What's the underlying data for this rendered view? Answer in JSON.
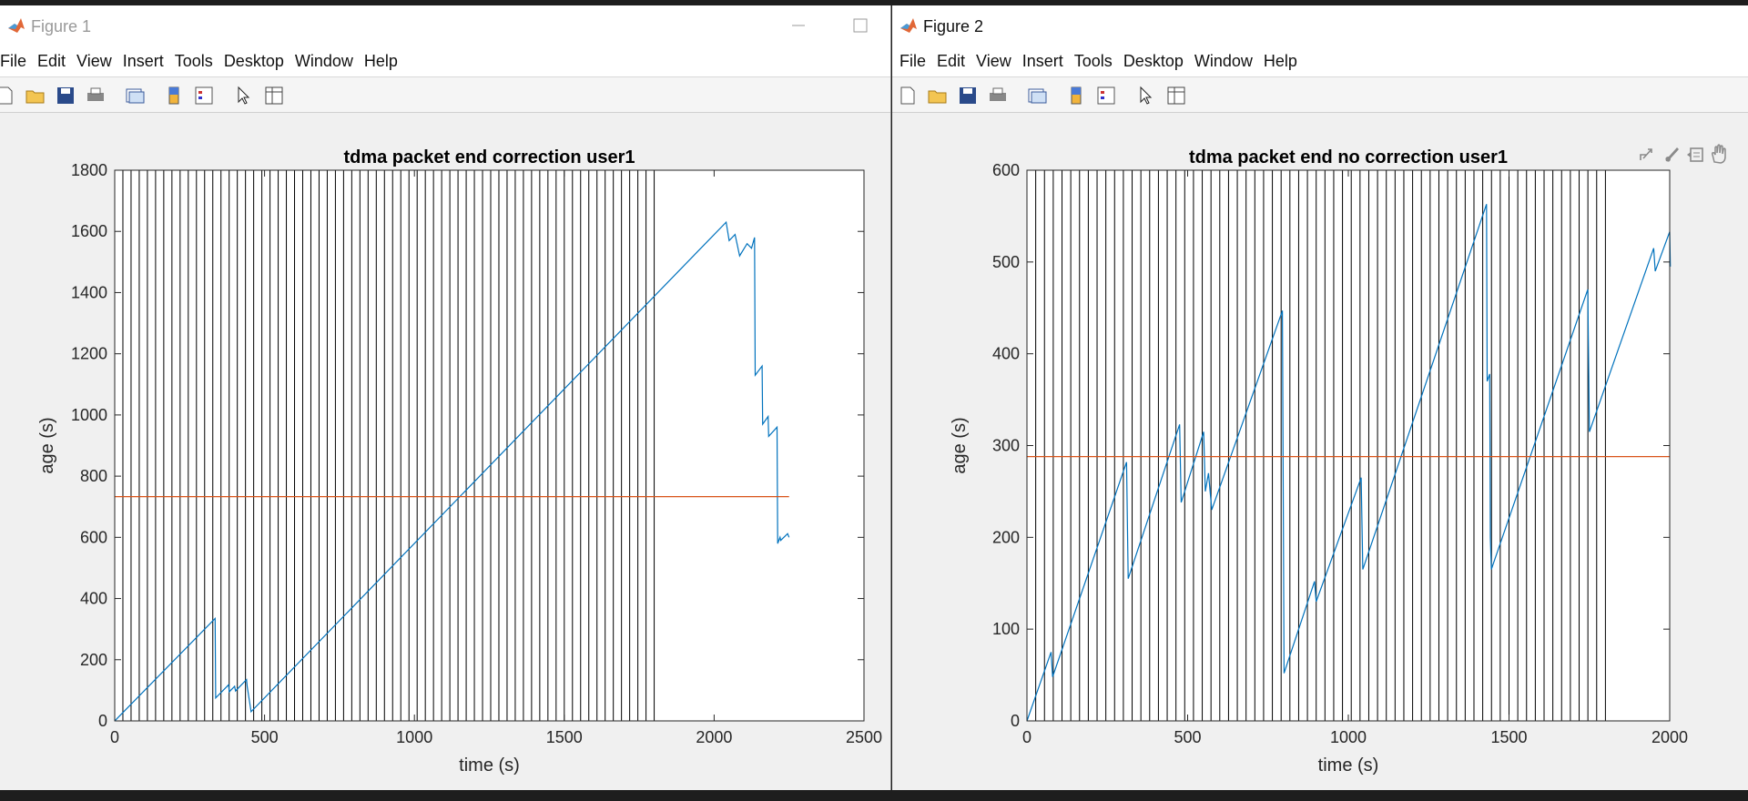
{
  "colors": {
    "data_line": "#0072BD",
    "mean_line": "#D95319",
    "grid_lines": "#000000",
    "axes": "#262626"
  },
  "icons": [
    "matlab-logo-icon",
    "new-figure-icon",
    "open-file-icon",
    "save-icon",
    "print-icon",
    "link-plot-icon",
    "colorbar-icon",
    "legend-icon",
    "pointer-icon",
    "property-inspector-icon",
    "export-icon",
    "brush-icon",
    "data-tips-icon",
    "pan-hand-icon",
    "minimize-icon",
    "maximize-icon"
  ],
  "windows": [
    {
      "title": "Figure 1",
      "menu": [
        "File",
        "Edit",
        "View",
        "Insert",
        "Tools",
        "Desktop",
        "Window",
        "Help"
      ]
    },
    {
      "title": "Figure 2",
      "menu": [
        "File",
        "Edit",
        "View",
        "Insert",
        "Tools",
        "Desktop",
        "Window",
        "Help"
      ]
    }
  ],
  "chart_data": [
    {
      "type": "line",
      "title": "tdma packet end correction user1",
      "xlabel": "time (s)",
      "ylabel": "age (s)",
      "xlim": [
        0,
        2500
      ],
      "ylim": [
        0,
        1800
      ],
      "xticks": [
        0,
        500,
        1000,
        1500,
        2000,
        2500
      ],
      "yticks": [
        0,
        200,
        400,
        600,
        800,
        1000,
        1200,
        1400,
        1600,
        1800
      ],
      "vlines_start": 0,
      "vlines_end": 1800,
      "vlines_count": 67,
      "series": [
        {
          "x": [
            0,
            335,
            337,
            380,
            382,
            400,
            403,
            440,
            442,
            455,
            2040,
            2050,
            2070,
            2085,
            2110,
            2125,
            2135,
            2137,
            2160,
            2162,
            2180,
            2182,
            2210,
            2212,
            2220,
            2222,
            2245,
            2250
          ],
          "y": [
            0,
            335,
            75,
            118,
            95,
            113,
            98,
            135,
            113,
            30,
            1630,
            1570,
            1590,
            1520,
            1560,
            1545,
            1580,
            1130,
            1160,
            970,
            995,
            930,
            960,
            580,
            600,
            590,
            612,
            600
          ]
        },
        {
          "x": [
            0,
            2250
          ],
          "y": [
            733,
            733
          ]
        }
      ]
    },
    {
      "type": "line",
      "title": "tdma packet end no correction user1",
      "xlabel": "time (s)",
      "ylabel": "age (s)",
      "xlim": [
        0,
        2000
      ],
      "ylim": [
        0,
        600
      ],
      "xticks": [
        0,
        500,
        1000,
        1500,
        2000
      ],
      "yticks": [
        0,
        100,
        200,
        300,
        400,
        500,
        600
      ],
      "vlines_start": 0,
      "vlines_end": 1800,
      "vlines_count": 67,
      "series": [
        {
          "x": [
            0,
            75,
            80,
            310,
            315,
            475,
            480,
            550,
            555,
            565,
            575,
            795,
            800,
            895,
            900,
            1040,
            1045,
            1430,
            1432,
            1440,
            1442,
            1445,
            1450,
            1745,
            1750,
            1950,
            1955,
            2000,
            2002
          ],
          "y": [
            0,
            75,
            48,
            282,
            155,
            323,
            238,
            315,
            250,
            270,
            230,
            447,
            52,
            152,
            130,
            265,
            165,
            563,
            370,
            378,
            200,
            165,
            170,
            470,
            315,
            515,
            490,
            533,
            495
          ]
        },
        {
          "x": [
            0,
            2000
          ],
          "y": [
            288,
            288
          ]
        }
      ]
    }
  ]
}
